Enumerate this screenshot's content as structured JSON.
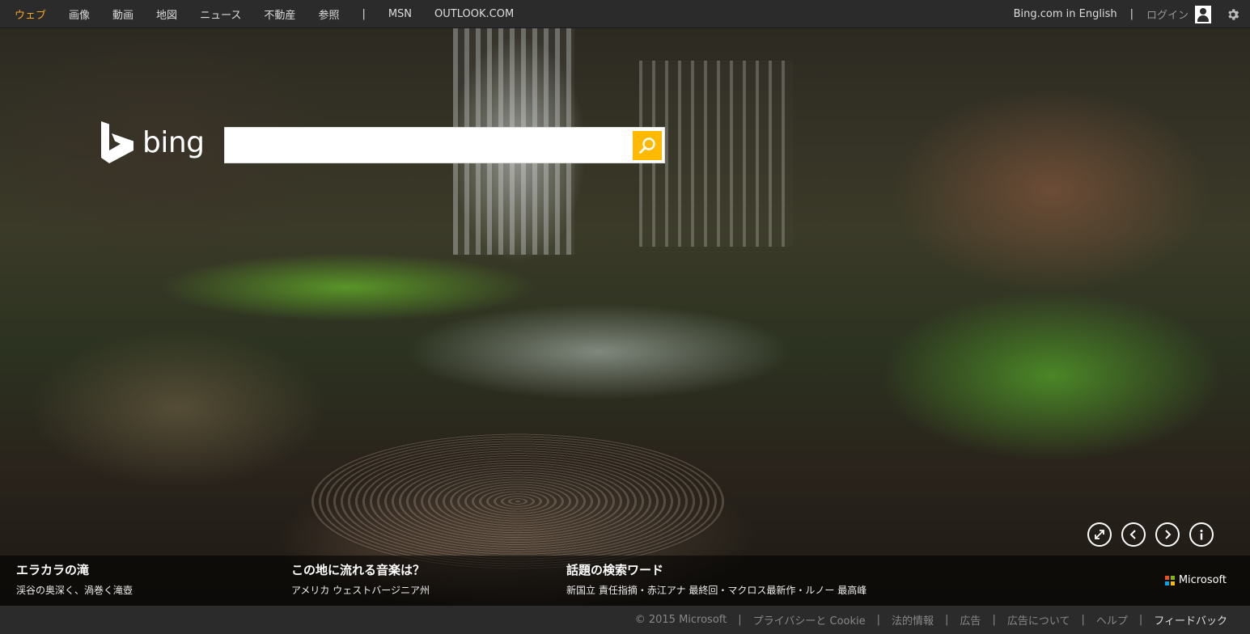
{
  "nav": {
    "items": [
      {
        "label": "ウェブ",
        "active": true
      },
      {
        "label": "画像"
      },
      {
        "label": "動画"
      },
      {
        "label": "地図"
      },
      {
        "label": "ニュース"
      },
      {
        "label": "不動産"
      },
      {
        "label": "参照"
      }
    ],
    "separator": "|",
    "extra": [
      {
        "label": "MSN"
      },
      {
        "label": "OUTLOOK.COM"
      }
    ],
    "english_label": "Bing.com in English",
    "right_separator": "|",
    "login_label": "ログイン",
    "active_color": "#f5a623"
  },
  "logo": {
    "text": "bing"
  },
  "search": {
    "value": "",
    "placeholder": "",
    "button_color": "#ffb900"
  },
  "controls": [
    "expand-icon",
    "previous-icon",
    "next-icon",
    "info-icon"
  ],
  "info": [
    {
      "title": "エラカラの滝",
      "subtitle": "渓谷の奥深く、渦巻く滝壺"
    },
    {
      "title": "この地に流れる音楽は？",
      "subtitle": "アメリカ ウェストバージニア州"
    },
    {
      "title": "話題の検索ワード",
      "subtitle": "新国立 責任指摘・赤江アナ 最終回・マクロス最新作・ルノー 最高峰"
    }
  ],
  "brand": {
    "label": "Microsoft",
    "colors": [
      "#f25022",
      "#7fba00",
      "#00a4ef",
      "#ffb900"
    ]
  },
  "footer": {
    "copyright": "© 2015 Microsoft",
    "separator": "|",
    "links": [
      "プライバシーと Cookie",
      "法的情報",
      "広告",
      "広告について",
      "ヘルプ"
    ],
    "feedback": "フィードバック"
  }
}
